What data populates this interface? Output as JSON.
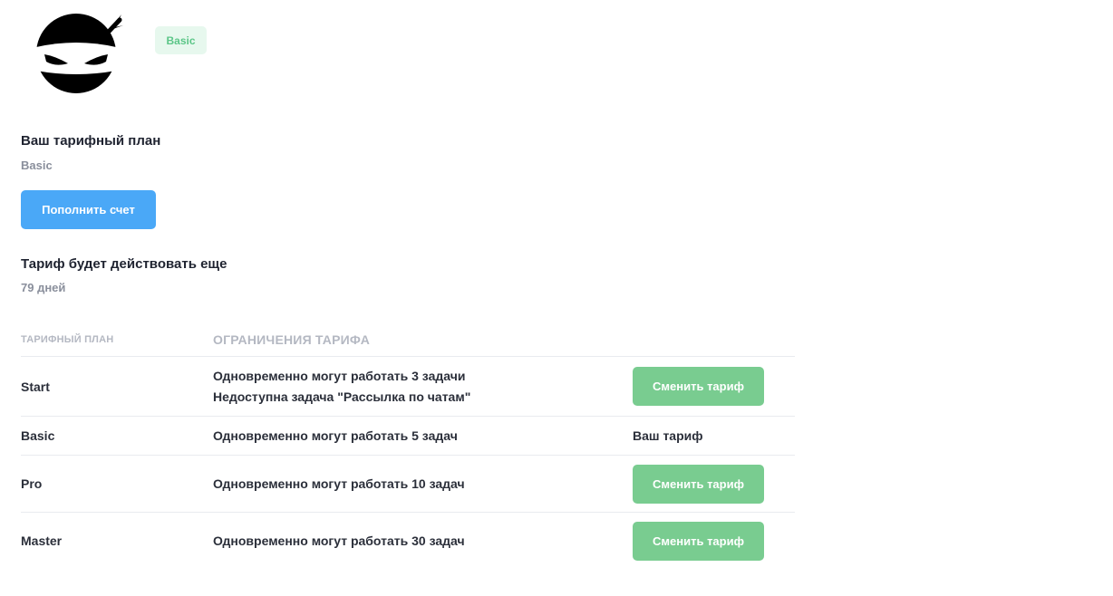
{
  "profile": {
    "avatar_icon": "ninja-avatar-icon",
    "plan_badge": "Basic",
    "badge_color": "#5cc688"
  },
  "current_plan": {
    "title": "Ваш тарифный план",
    "value": "Basic"
  },
  "topup_button": {
    "label": "Пополнить счет",
    "color": "#4aa8f7"
  },
  "validity": {
    "title": "Тариф будет действовать еще",
    "value": "79 дней"
  },
  "table": {
    "headers": {
      "plan": "ТАРИФНЫЙ ПЛАН",
      "limits": "ОГРАНИЧЕНИЯ ТАРИФА"
    },
    "rows": [
      {
        "plan": "Start",
        "limits": [
          "Одновременно могут работать 3 задачи",
          "Недоступна задача \"Рассылка по чатам\""
        ],
        "action": "Сменить тариф"
      },
      {
        "plan": "Basic",
        "limits": [
          "Одновременно могут работать 5 задач"
        ],
        "action": "Ваш тариф"
      },
      {
        "plan": "Pro",
        "limits": [
          "Одновременно могут работать 10 задач"
        ],
        "action": "Сменить тариф"
      },
      {
        "plan": "Master",
        "limits": [
          "Одновременно могут работать 30 задач"
        ],
        "action": "Сменить тариф"
      }
    ],
    "button_color": "#79cc90"
  }
}
